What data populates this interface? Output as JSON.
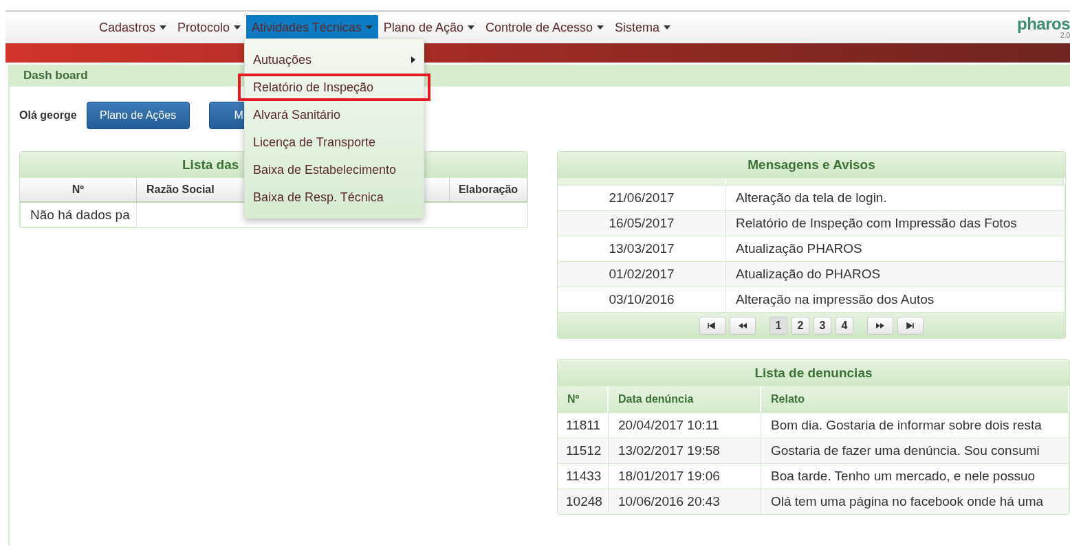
{
  "navbar": {
    "menus": [
      {
        "label": "Cadastros",
        "selected": false
      },
      {
        "label": "Protocolo",
        "selected": false
      },
      {
        "label": "Atividades Técnicas",
        "selected": true
      },
      {
        "label": "Plano de Ação",
        "selected": false
      },
      {
        "label": "Controle de Acesso",
        "selected": false
      },
      {
        "label": "Sistema",
        "selected": false
      }
    ],
    "logo": {
      "name": "pharos",
      "version": "2.0"
    }
  },
  "dropdown": {
    "items": [
      {
        "label": "Autuações",
        "has_submenu": true,
        "highlighted": false
      },
      {
        "label": "Relatório de Inspeção",
        "has_submenu": false,
        "highlighted": true
      },
      {
        "label": "Alvará Sanitário",
        "has_submenu": false,
        "highlighted": false
      },
      {
        "label": "Licença de Transporte",
        "has_submenu": false,
        "highlighted": false
      },
      {
        "label": "Baixa de Estabelecimento",
        "has_submenu": false,
        "highlighted": false
      },
      {
        "label": "Baixa de Resp. Técnica",
        "has_submenu": false,
        "highlighted": false
      }
    ]
  },
  "dashboard": {
    "title": "Dash board",
    "greeting": "Olá george",
    "buttons": [
      "Plano de Ações",
      "M"
    ]
  },
  "left_panel": {
    "title": "Lista das",
    "columns": [
      "Nº",
      "Razão Social",
      "",
      "Elaboração"
    ],
    "empty_message": "Não há dados pa"
  },
  "messages_panel": {
    "title": "Mensagens e Avisos",
    "rows": [
      {
        "date": "21/06/2017",
        "text": "Alteração da tela de login."
      },
      {
        "date": "16/05/2017",
        "text": "Relatório de Inspeção com Impressão das Fotos"
      },
      {
        "date": "13/03/2017",
        "text": "Atualização PHAROS"
      },
      {
        "date": "01/02/2017",
        "text": "Atualização do PHAROS"
      },
      {
        "date": "03/10/2016",
        "text": "Alteração na impressão dos Autos"
      }
    ],
    "pager": {
      "nav": [
        {
          "kind": "first"
        },
        {
          "kind": "prev"
        }
      ],
      "pages": [
        {
          "label": "1",
          "selected": true
        },
        {
          "label": "2",
          "selected": false
        },
        {
          "label": "3",
          "selected": false
        },
        {
          "label": "4",
          "selected": false
        }
      ],
      "nav_end": [
        {
          "kind": "next"
        },
        {
          "kind": "last"
        }
      ]
    }
  },
  "complaints_panel": {
    "title": "Lista de denuncias",
    "columns": [
      "Nº",
      "Data denúncia",
      "Relato"
    ],
    "rows": [
      {
        "number": "11811",
        "date": "20/04/2017 10:11",
        "text": "Bom dia. Gostaria de informar sobre dois resta"
      },
      {
        "number": "11512",
        "date": "13/02/2017 19:58",
        "text": "Gostaria de fazer uma denúncia. Sou consumi"
      },
      {
        "number": "11433",
        "date": "18/01/2017 19:06",
        "text": "Boa tarde. Tenho um mercado, e nele possuo"
      },
      {
        "number": "10248",
        "date": "10/06/2016 20:43",
        "text": "Olá tem uma página no facebook onde há uma"
      }
    ]
  }
}
